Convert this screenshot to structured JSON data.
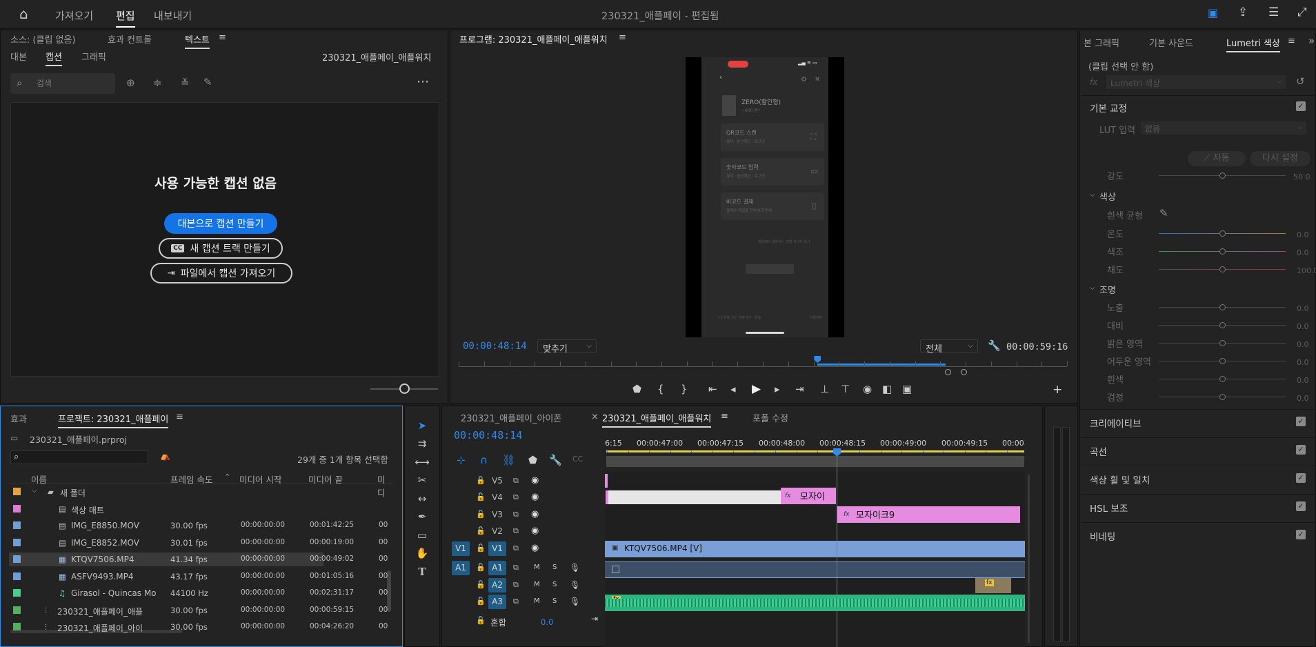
{
  "topbar": {
    "home_icon": "home-icon",
    "workspaces": [
      "가져오기",
      "편집",
      "내보내기"
    ],
    "title": "230321_애플페이 - 편집됨"
  },
  "source_panel": {
    "tabs": [
      "소스: (클립 없음)",
      "효과 컨트롤",
      "텍스트"
    ],
    "menu_icon": "≡",
    "subtabs": [
      "대본",
      "캡션",
      "그래픽"
    ],
    "sequence_name": "230321_애플페이_애플워치",
    "search_placeholder": "검색",
    "empty_title": "사용 가능한 캡션 없음",
    "btn_from_script": "대본으로 캡션 만들기",
    "btn_new_track": "새 캡션 트랙 만들기",
    "btn_import": "파일에서 캡션 가져오기",
    "cc_glyph": "CC"
  },
  "program_panel": {
    "title": "프로그램: 230321_애플페이_애플워치",
    "menu_icon": "≡",
    "timecode_left": "00:00:48:14",
    "fit_label": "맞추기",
    "quality_label": "전체",
    "timecode_right": "00:00:59:16",
    "playhead_fraction": 0.59,
    "in_fraction": 0.59,
    "out_fraction": 0.8,
    "phone": {
      "header_title": "ZERO(할인형)",
      "header_sub": "~000 원*",
      "cards": [
        {
          "title": "QR코드 스캔",
          "sub": "결제 · 본인확인 · 로그인"
        },
        {
          "title": "숫자코드 입력",
          "sub": "결제 · 본인확인 · 로그인"
        },
        {
          "title": "바코드 결제",
          "sub": "결제와 적립을 한번에 한번에"
        }
      ],
      "link_text": "애플페이 결제하는 방법 자세히 보기",
      "footer_left": "내 만료 기간 연장하기 · 정보",
      "footer_right": "이용약관"
    }
  },
  "project_panel": {
    "tabs": [
      "효과",
      "프로젝트: 230321_애플페이"
    ],
    "menu_icon": "≡",
    "project_file": "230321_애플페이.prproj",
    "selection_info": "29개 중 1개 항목 선택함",
    "columns": [
      "이름",
      "프레임 속도",
      "미디어 시작",
      "미디어 끝",
      "미디"
    ],
    "rows": [
      {
        "swatch": "#e8a33a",
        "name": "새 폴더",
        "fps": "",
        "start": "",
        "end": "",
        "extra": "",
        "kind": "folder"
      },
      {
        "swatch": "#e07ad9",
        "name": "색상 매트",
        "fps": "",
        "start": "",
        "end": "",
        "extra": "",
        "kind": "file"
      },
      {
        "swatch": "#6f9fd8",
        "name": "IMG_E8850.MOV",
        "fps": "30.00 fps",
        "start": "00:00:00:00",
        "end": "00:01:42:25",
        "extra": "00",
        "kind": "file"
      },
      {
        "swatch": "#6f9fd8",
        "name": "IMG_E8852.MOV",
        "fps": "30.01 fps",
        "start": "00:00:00:00",
        "end": "00:00:19:00",
        "extra": "00",
        "kind": "file"
      },
      {
        "swatch": "#6f9fd8",
        "name": "KTQV7506.MP4",
        "fps": "41.34 fps",
        "start": "00:00:00:00",
        "end": "00:00:49:02",
        "extra": "00",
        "kind": "video",
        "selected": true
      },
      {
        "swatch": "#6f9fd8",
        "name": "ASFV9493.MP4",
        "fps": "43.17 fps",
        "start": "00:00:00:00",
        "end": "00:01:05:16",
        "extra": "00",
        "kind": "video"
      },
      {
        "swatch": "#3fcf8e",
        "name": "Girasol - Quincas Mo",
        "fps": "44100 Hz",
        "start": "00;00;00;00",
        "end": "00;02;31;17",
        "extra": "00",
        "kind": "audio"
      },
      {
        "swatch": "#4fb35a",
        "name": "230321_애플페이_애플",
        "fps": "30.00 fps",
        "start": "00:00:00:00",
        "end": "00:00:59:15",
        "extra": "00",
        "kind": "sequence"
      },
      {
        "swatch": "#4fb35a",
        "name": "230321_애플페이_아이",
        "fps": "30.00 fps",
        "start": "00:00:00:00",
        "end": "00:04:26:20",
        "extra": "00",
        "kind": "sequence"
      }
    ]
  },
  "timeline": {
    "tabs": [
      "230321_애플페이_아이폰",
      "230321_애플페이_애플워치",
      "포폴 수정"
    ],
    "close_glyph": "×",
    "menu_icon": "≡",
    "timecode": "00:00:48:14",
    "ruler": [
      "6:15",
      "00:00:47:00",
      "00:00:47:15",
      "00:00:48:00",
      "00:00:48:15",
      "00:00:49:00",
      "00:00:49:15",
      "00:00"
    ],
    "video_tracks": [
      "V5",
      "V4",
      "V3",
      "V2",
      "V1"
    ],
    "audio_tracks": [
      "A1",
      "A2",
      "A3"
    ],
    "source_v": "V1",
    "source_a": "A1",
    "mix_label": "혼합",
    "mix_value": "0.0",
    "clip_mosaic_a": "모자이",
    "clip_mosaic_b": "모자이크9",
    "clip_video": "KTQV7506.MP4 [V]",
    "fx_badge": "fx",
    "m": "M",
    "s": "S"
  },
  "lumetri": {
    "tabs": [
      "본 그래픽",
      "기본 사운드",
      "Lumetri 색상"
    ],
    "menu_icon": "≡",
    "clip_info": "(클립 선택 안 함)",
    "fx_label": "fx",
    "fx_value": "Lumetri 색상",
    "section_basic": "기본 교정",
    "lut_label": "LUT 입력",
    "lut_value": "없음",
    "btn_auto": "자동",
    "btn_reset": "다시 설정",
    "intensity_label": "강도",
    "intensity_value": "50.0",
    "color_section": "색상",
    "wb_label": "흰색 균형",
    "color_sliders": [
      {
        "label": "온도",
        "value": "0.0"
      },
      {
        "label": "색조",
        "value": "0.0"
      },
      {
        "label": "채도",
        "value": "100.0"
      }
    ],
    "light_section": "조명",
    "light_sliders": [
      {
        "label": "노출",
        "value": "0.0"
      },
      {
        "label": "대비",
        "value": "0.0"
      },
      {
        "label": "밝은 영역",
        "value": "0.0"
      },
      {
        "label": "어두운 영역",
        "value": "0.0"
      },
      {
        "label": "흰색",
        "value": "0.0"
      },
      {
        "label": "검정",
        "value": "0.0"
      }
    ],
    "sections": [
      "크리에이티브",
      "곡선",
      "색상 휠 및 일치",
      "HSL 보조",
      "비네팅"
    ],
    "check": "✓"
  },
  "colors": {
    "accent": "#2d8ceb",
    "pink_clip": "#e58ce0",
    "video_clip": "#7a9fd6",
    "audio_clip": "#2fb57f",
    "track_target": "#1f5c86"
  }
}
